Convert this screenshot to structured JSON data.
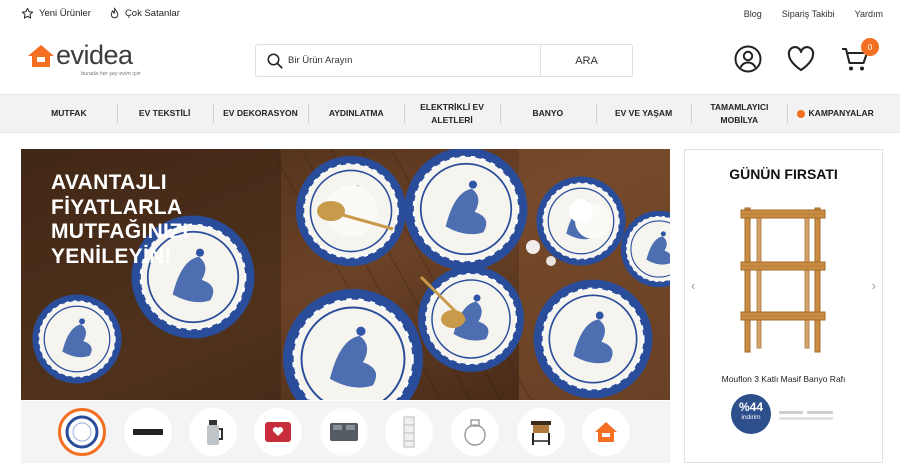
{
  "topbar": {
    "new_products": "Yeni Ürünler",
    "best_sellers": "Çok Satanlar",
    "links": [
      "Blog",
      "Sipariş Takibi",
      "Yardım"
    ]
  },
  "header": {
    "logo_text": "evidea",
    "logo_tagline": "burada her şey evim için",
    "search_placeholder": "Bir Ürün Arayın",
    "search_button": "ARA",
    "cart_count": "0",
    "icons": [
      "user-icon",
      "heart-icon",
      "cart-icon"
    ]
  },
  "nav": {
    "categories": [
      "MUTFAK",
      "EV TEKSTİLİ",
      "EV DEKORASYON",
      "AYDINLATMA",
      "ELEKTRİKLİ EV ALETLERİ",
      "BANYO",
      "EV VE YAŞAM",
      "TAMAMLAYICI MOBİLYA",
      "KAMPANYALAR"
    ]
  },
  "hero": {
    "headline": [
      "AVANTAJLI",
      "FİYATLARLA",
      "MUTFAĞINIZI",
      "YENİLEYİN!"
    ]
  },
  "thumbnails": {
    "items": [
      "plate-icon",
      "tray-icon",
      "kettle-icon",
      "pillow-icon",
      "bedding-icon",
      "shelf-icon",
      "jar-icon",
      "nightstand-icon",
      "home-icon"
    ]
  },
  "deal": {
    "title": "GÜNÜN FIRSATI",
    "product_name": "Mouflon 3 Katlı Masif Banyo Rafı",
    "discount_pct": "%44",
    "discount_label": "indirim"
  },
  "colors": {
    "accent": "#f36f21",
    "badge": "#2d4f8c",
    "nav_bg": "#f2f2f2"
  }
}
